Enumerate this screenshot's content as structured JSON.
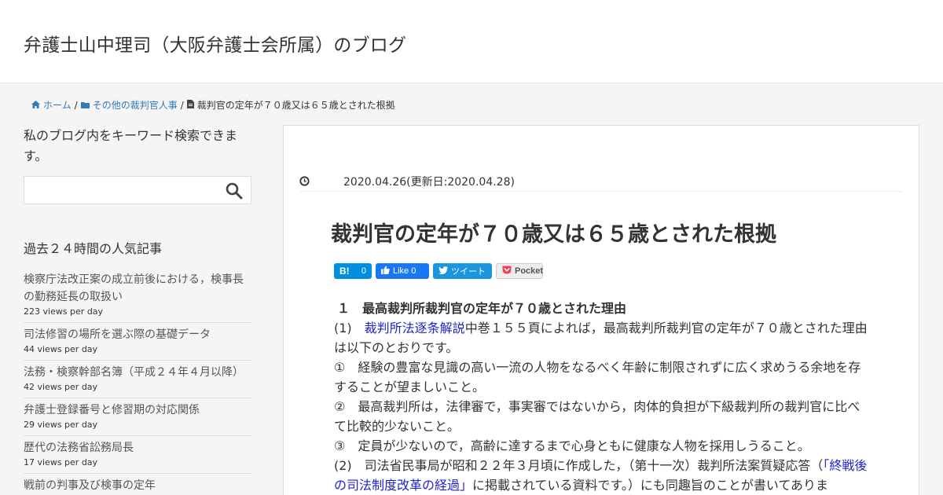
{
  "header": {
    "site_title": "弁護士山中理司（大阪弁護士会所属）のブログ"
  },
  "breadcrumb": {
    "home": "ホーム",
    "category": "その他の裁判官人事",
    "current": "裁判官の定年が７０歳又は６５歳とされた根拠"
  },
  "sidebar": {
    "search_heading": "私のブログ内をキーワード検索できます。",
    "search_placeholder": "",
    "popular_heading": "過去２４時間の人気記事",
    "popular": [
      {
        "title": "検察庁法改正案の成立前後における，検事長の勤務延長の取扱い",
        "views": "223 views per day"
      },
      {
        "title": "司法修習の場所を選ぶ際の基礎データ",
        "views": "44 views per day"
      },
      {
        "title": "法務・検察幹部名簿（平成２４年４月以降）",
        "views": "42 views per day"
      },
      {
        "title": "弁護士登録番号と修習期の対応関係",
        "views": "29 views per day"
      },
      {
        "title": "歴代の法務省訟務局長",
        "views": "17 views per day"
      },
      {
        "title": "戦前の判事及び検事の定年",
        "views": ""
      }
    ]
  },
  "post": {
    "date": "2020.04.26(更新日:2020.04.28)",
    "title": "裁判官の定年が７０歳又は６５歳とされた根拠",
    "share": {
      "hatena_label": "B!",
      "hatena_count": "0",
      "facebook": "Like 0",
      "twitter": "ツイート",
      "pocket": "Pocket"
    },
    "content": {
      "h1": "１　最高裁判所裁判官の定年が７０歳とされた理由",
      "p1_prefix": "(1)　",
      "p1_link": "裁判所法逐条解説",
      "p1_rest": "中巻１５５頁によれば，最高裁判所裁判官の定年が７０歳とされた理由は以下のとおりです。",
      "p2": "①　経験の豊富な見識の高い一流の人物をなるべく年齢に制限されずに広く求めうる余地を存することが望ましいこと。",
      "p3": "②　最高裁判所は，法律審で，事実審ではないから，肉体的負担が下級裁判所の裁判官に比べて比較的少ないこと。",
      "p4": "③　定員が少ないので，高齢に達するまで心身ともに健康な人物を採用しうること。",
      "p5_prefix": "(2)　司法省民事局が昭和２２年３月頃に作成した，（第十一次）裁判所法案質疑応答（",
      "p5_link": "「終戦後の司法制度改革の経過」",
      "p5_rest": "に掲載されている資料です。）にも同趣旨のことが書いてありま"
    }
  }
}
